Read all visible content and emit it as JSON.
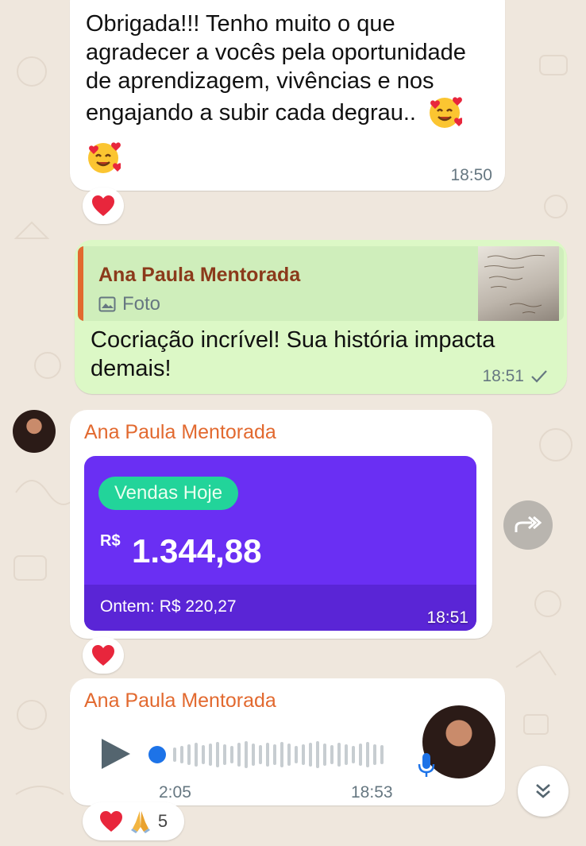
{
  "messages": {
    "m1": {
      "text_lines": [
        "Obrigada!!! Tenho muito o que",
        "agradecer a vocês pela oportunidade",
        "de aprendizagem, vivências e nos",
        "engajando a subir cada degrau.."
      ],
      "time": "18:50",
      "reaction": "heart"
    },
    "m2": {
      "quote_author": "Ana Paula Mentorada",
      "quote_type": "Foto",
      "text_lines": [
        "Cocriação incrível! Sua história impacta",
        "demais!"
      ],
      "time": "18:51",
      "status": "sent"
    },
    "m3": {
      "sender": "Ana Paula Mentorada",
      "card": {
        "badge": "Vendas Hoje",
        "currency": "R$",
        "amount": "1.344,88",
        "yesterday": "Ontem: R$ 220,27"
      },
      "time": "18:51",
      "reaction": "heart"
    },
    "m4": {
      "sender": "Ana Paula Mentorada",
      "duration": "2:05",
      "time": "18:53",
      "reaction_count": "5",
      "reactions": [
        "heart",
        "folded-hands"
      ]
    }
  },
  "colors": {
    "wallpaper": "#efe7dd",
    "bubble_in": "#ffffff",
    "bubble_out": "#dcf8c6",
    "sender": "#e2692f",
    "quote_author": "#8b3a1b",
    "card": "#6a2ff3",
    "badge": "#22d49a",
    "audio_blue": "#1d73e8"
  }
}
